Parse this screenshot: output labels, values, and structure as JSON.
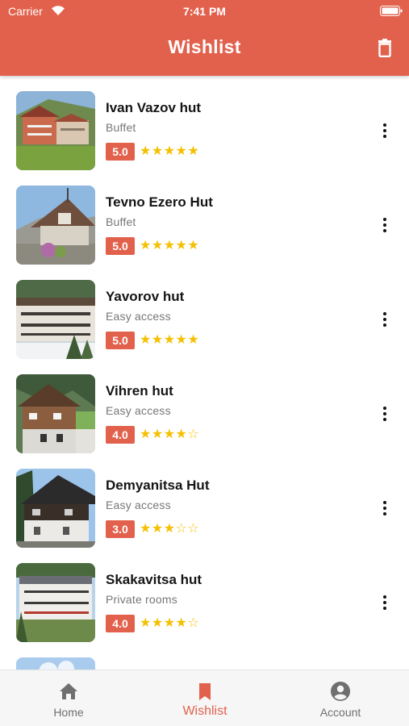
{
  "status_bar": {
    "carrier": "Carrier",
    "time": "7:41 PM"
  },
  "header": {
    "title": "Wishlist"
  },
  "icons": {
    "wifi": "wifi-icon",
    "battery": "battery-icon",
    "delete": "trash-icon",
    "menu": "more-vertical-icon",
    "home": "home-icon",
    "wishlist": "bookmark-icon",
    "account": "account-circle-icon",
    "star_full": "★",
    "star_empty": "☆"
  },
  "colors": {
    "accent": "#e2614d",
    "star": "#f5c000",
    "inactive": "#6f6f6f"
  },
  "items": [
    {
      "name": "Ivan Vazov hut",
      "subtitle": "Buffet",
      "rating": "5.0",
      "stars": 5
    },
    {
      "name": "Tevno Ezero Hut",
      "subtitle": "Buffet",
      "rating": "5.0",
      "stars": 5
    },
    {
      "name": "Yavorov hut",
      "subtitle": "Easy access",
      "rating": "5.0",
      "stars": 5
    },
    {
      "name": "Vihren hut",
      "subtitle": "Easy access",
      "rating": "4.0",
      "stars": 4
    },
    {
      "name": "Demyanitsa Hut",
      "subtitle": "Easy access",
      "rating": "3.0",
      "stars": 3
    },
    {
      "name": "Skakavitsa hut",
      "subtitle": "Private rooms",
      "rating": "4.0",
      "stars": 4
    }
  ],
  "bottom_nav": [
    {
      "label": "Home",
      "active": false
    },
    {
      "label": "Wishlist",
      "active": true
    },
    {
      "label": "Account",
      "active": false
    }
  ]
}
